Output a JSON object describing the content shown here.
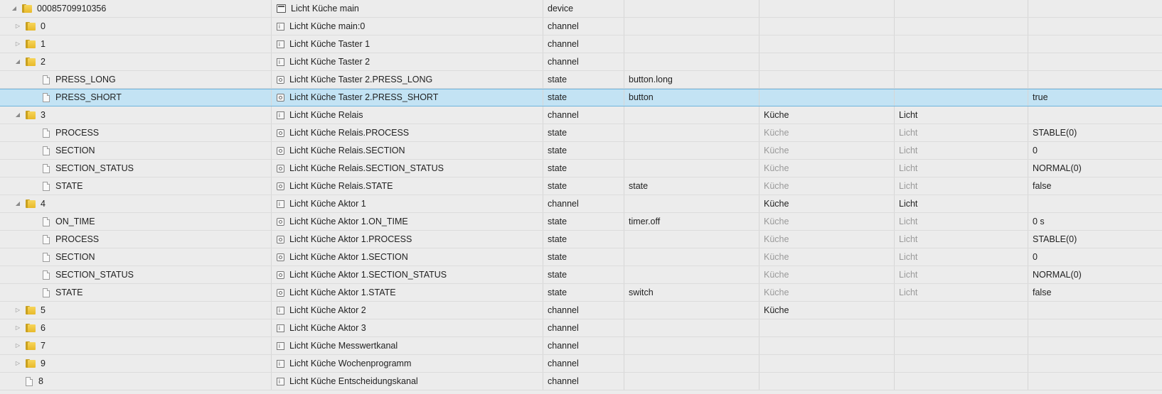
{
  "rows": [
    {
      "id": "00085709910356",
      "name": "Licht Küche main",
      "type": "device",
      "role": "",
      "room": "",
      "func": "",
      "value": "",
      "kind": "folder",
      "indent": 1,
      "toggle": "open",
      "icon": "device",
      "selected": false,
      "muted": false
    },
    {
      "id": "0",
      "name": "Licht Küche main:0",
      "type": "channel",
      "role": "",
      "room": "",
      "func": "",
      "value": "",
      "kind": "folder",
      "indent": 2,
      "toggle": "closed",
      "icon": "channel",
      "selected": false,
      "muted": false
    },
    {
      "id": "1",
      "name": "Licht Küche Taster 1",
      "type": "channel",
      "role": "",
      "room": "",
      "func": "",
      "value": "",
      "kind": "folder",
      "indent": 2,
      "toggle": "closed",
      "icon": "channel",
      "selected": false,
      "muted": false
    },
    {
      "id": "2",
      "name": "Licht Küche Taster 2",
      "type": "channel",
      "role": "",
      "room": "",
      "func": "",
      "value": "",
      "kind": "folder",
      "indent": 2,
      "toggle": "open",
      "icon": "channel",
      "selected": false,
      "muted": false
    },
    {
      "id": "PRESS_LONG",
      "name": "Licht Küche Taster 2.PRESS_LONG",
      "type": "state",
      "role": "button.long",
      "room": "",
      "func": "",
      "value": "",
      "kind": "file",
      "indent": 3,
      "toggle": "",
      "icon": "state",
      "selected": false,
      "muted": false
    },
    {
      "id": "PRESS_SHORT",
      "name": "Licht Küche Taster 2.PRESS_SHORT",
      "type": "state",
      "role": "button",
      "room": "",
      "func": "",
      "value": "true",
      "kind": "file",
      "indent": 3,
      "toggle": "",
      "icon": "state",
      "selected": true,
      "muted": false
    },
    {
      "id": "3",
      "name": "Licht Küche Relais",
      "type": "channel",
      "role": "",
      "room": "Küche",
      "func": "Licht",
      "value": "",
      "kind": "folder",
      "indent": 2,
      "toggle": "open",
      "icon": "channel",
      "selected": false,
      "muted": false
    },
    {
      "id": "PROCESS",
      "name": "Licht Küche Relais.PROCESS",
      "type": "state",
      "role": "",
      "room": "Küche",
      "func": "Licht",
      "value": "STABLE(0)",
      "kind": "file",
      "indent": 3,
      "toggle": "",
      "icon": "state",
      "selected": false,
      "muted": true
    },
    {
      "id": "SECTION",
      "name": "Licht Küche Relais.SECTION",
      "type": "state",
      "role": "",
      "room": "Küche",
      "func": "Licht",
      "value": "0",
      "kind": "file",
      "indent": 3,
      "toggle": "",
      "icon": "state",
      "selected": false,
      "muted": true
    },
    {
      "id": "SECTION_STATUS",
      "name": "Licht Küche Relais.SECTION_STATUS",
      "type": "state",
      "role": "",
      "room": "Küche",
      "func": "Licht",
      "value": "NORMAL(0)",
      "kind": "file",
      "indent": 3,
      "toggle": "",
      "icon": "state",
      "selected": false,
      "muted": true
    },
    {
      "id": "STATE",
      "name": "Licht Küche Relais.STATE",
      "type": "state",
      "role": "state",
      "room": "Küche",
      "func": "Licht",
      "value": "false",
      "kind": "file",
      "indent": 3,
      "toggle": "",
      "icon": "state",
      "selected": false,
      "muted": true
    },
    {
      "id": "4",
      "name": "Licht Küche Aktor 1",
      "type": "channel",
      "role": "",
      "room": "Küche",
      "func": "Licht",
      "value": "",
      "kind": "folder",
      "indent": 2,
      "toggle": "open",
      "icon": "channel",
      "selected": false,
      "muted": false
    },
    {
      "id": "ON_TIME",
      "name": "Licht Küche Aktor 1.ON_TIME",
      "type": "state",
      "role": "timer.off",
      "room": "Küche",
      "func": "Licht",
      "value": "0 s",
      "kind": "file",
      "indent": 3,
      "toggle": "",
      "icon": "state",
      "selected": false,
      "muted": true
    },
    {
      "id": "PROCESS",
      "name": "Licht Küche Aktor 1.PROCESS",
      "type": "state",
      "role": "",
      "room": "Küche",
      "func": "Licht",
      "value": "STABLE(0)",
      "kind": "file",
      "indent": 3,
      "toggle": "",
      "icon": "state",
      "selected": false,
      "muted": true
    },
    {
      "id": "SECTION",
      "name": "Licht Küche Aktor 1.SECTION",
      "type": "state",
      "role": "",
      "room": "Küche",
      "func": "Licht",
      "value": "0",
      "kind": "file",
      "indent": 3,
      "toggle": "",
      "icon": "state",
      "selected": false,
      "muted": true
    },
    {
      "id": "SECTION_STATUS",
      "name": "Licht Küche Aktor 1.SECTION_STATUS",
      "type": "state",
      "role": "",
      "room": "Küche",
      "func": "Licht",
      "value": "NORMAL(0)",
      "kind": "file",
      "indent": 3,
      "toggle": "",
      "icon": "state",
      "selected": false,
      "muted": true
    },
    {
      "id": "STATE",
      "name": "Licht Küche Aktor 1.STATE",
      "type": "state",
      "role": "switch",
      "room": "Küche",
      "func": "Licht",
      "value": "false",
      "kind": "file",
      "indent": 3,
      "toggle": "",
      "icon": "state",
      "selected": false,
      "muted": true
    },
    {
      "id": "5",
      "name": "Licht Küche Aktor 2",
      "type": "channel",
      "role": "",
      "room": "Küche",
      "func": "",
      "value": "",
      "kind": "folder",
      "indent": 2,
      "toggle": "closed",
      "icon": "channel",
      "selected": false,
      "muted": false
    },
    {
      "id": "6",
      "name": "Licht Küche Aktor 3",
      "type": "channel",
      "role": "",
      "room": "",
      "func": "",
      "value": "",
      "kind": "folder",
      "indent": 2,
      "toggle": "closed",
      "icon": "channel",
      "selected": false,
      "muted": false
    },
    {
      "id": "7",
      "name": "Licht Küche Messwertkanal",
      "type": "channel",
      "role": "",
      "room": "",
      "func": "",
      "value": "",
      "kind": "folder",
      "indent": 2,
      "toggle": "closed",
      "icon": "channel",
      "selected": false,
      "muted": false
    },
    {
      "id": "9",
      "name": "Licht Küche Wochenprogramm",
      "type": "channel",
      "role": "",
      "room": "",
      "func": "",
      "value": "",
      "kind": "folder",
      "indent": 2,
      "toggle": "closed",
      "icon": "channel",
      "selected": false,
      "muted": false
    },
    {
      "id": "8",
      "name": "Licht Küche Entscheidungskanal",
      "type": "channel",
      "role": "",
      "room": "",
      "func": "",
      "value": "",
      "kind": "file",
      "indent": 2,
      "toggle": "",
      "icon": "channel",
      "selected": false,
      "muted": false
    }
  ]
}
